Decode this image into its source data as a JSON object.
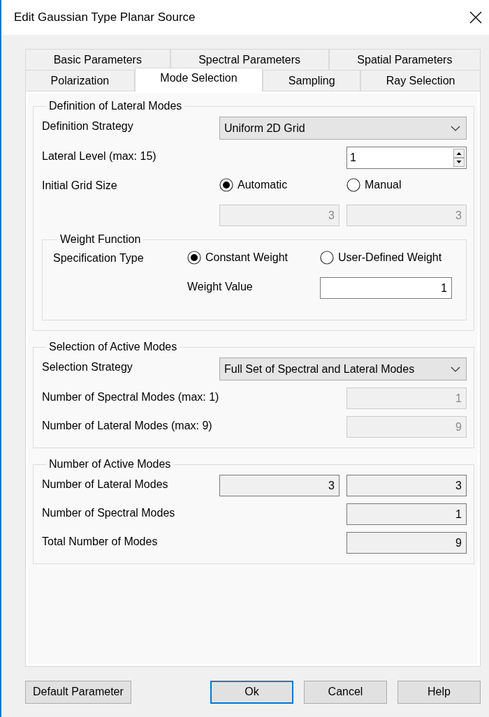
{
  "window": {
    "title": "Edit Gaussian Type Planar Source"
  },
  "tab_rows": [
    {
      "tabs": [
        {
          "label": "Basic Parameters",
          "selected": false
        },
        {
          "label": "Spectral Parameters",
          "selected": false
        },
        {
          "label": "Spatial Parameters",
          "selected": false
        }
      ]
    },
    {
      "tabs": [
        {
          "label": "Polarization",
          "selected": false
        },
        {
          "label": "Mode Selection",
          "selected": true
        },
        {
          "label": "Sampling",
          "selected": false
        },
        {
          "label": "Ray Selection",
          "selected": false
        }
      ]
    }
  ],
  "groups": [
    {
      "title": "Definition of Lateral Modes",
      "rows": [
        {
          "kind": "dropdown",
          "label": "Definition Strategy",
          "value": "Uniform 2D Grid"
        },
        {
          "kind": "spinner",
          "label": "Lateral Level (max: 15)",
          "value": "1"
        },
        {
          "kind": "radios",
          "label": "Initial Grid Size",
          "options": [
            {
              "label": "Automatic",
              "selected": true
            },
            {
              "label": "Manual",
              "selected": false
            }
          ]
        },
        {
          "kind": "fields",
          "fields": [
            {
              "value": "3",
              "disabled": true
            },
            {
              "value": "3",
              "disabled": true
            }
          ]
        }
      ],
      "subgroup": {
        "title": "Weight Function",
        "rows": [
          {
            "kind": "radios",
            "label": "Specification Type",
            "options": [
              {
                "label": "Constant Weight",
                "selected": true
              },
              {
                "label": "User-Defined Weight",
                "selected": false
              }
            ]
          },
          {
            "kind": "inline_field",
            "label": "Weight Value",
            "field": {
              "value": "1",
              "disabled": false
            }
          }
        ]
      }
    },
    {
      "title": "Selection of Active Modes",
      "rows": [
        {
          "kind": "dropdown",
          "label": "Selection Strategy",
          "value": "Full Set of Spectral and Lateral Modes"
        },
        {
          "kind": "fields",
          "label": "Number of Spectral Modes (max: 1)",
          "fields": [
            {
              "value": "1",
              "disabled": true
            }
          ]
        },
        {
          "kind": "fields",
          "label": "Number of Lateral Modes (max: 9)",
          "fields": [
            {
              "value": "9",
              "disabled": true
            }
          ]
        }
      ]
    },
    {
      "title": "Number of Active Modes",
      "rows": [
        {
          "kind": "fields",
          "label": "Number of Lateral Modes",
          "fields": [
            {
              "value": "3",
              "disabled": false,
              "kind": "readonly"
            },
            {
              "value": "3",
              "disabled": false,
              "kind": "readonly"
            }
          ]
        },
        {
          "kind": "fields",
          "label": "Number of Spectral Modes",
          "fields": [
            {
              "value": "1",
              "disabled": false,
              "kind": "readonly"
            }
          ]
        },
        {
          "kind": "fields",
          "label": "Total Number of Modes",
          "fields": [
            {
              "value": "9",
              "disabled": false,
              "kind": "readonly"
            }
          ]
        }
      ]
    }
  ],
  "left_button": {
    "label": "Default Parameter",
    "default": false
  },
  "buttons": [
    {
      "label": "Ok",
      "default": true
    },
    {
      "label": "Cancel",
      "default": false
    },
    {
      "label": "Help",
      "default": false
    }
  ]
}
